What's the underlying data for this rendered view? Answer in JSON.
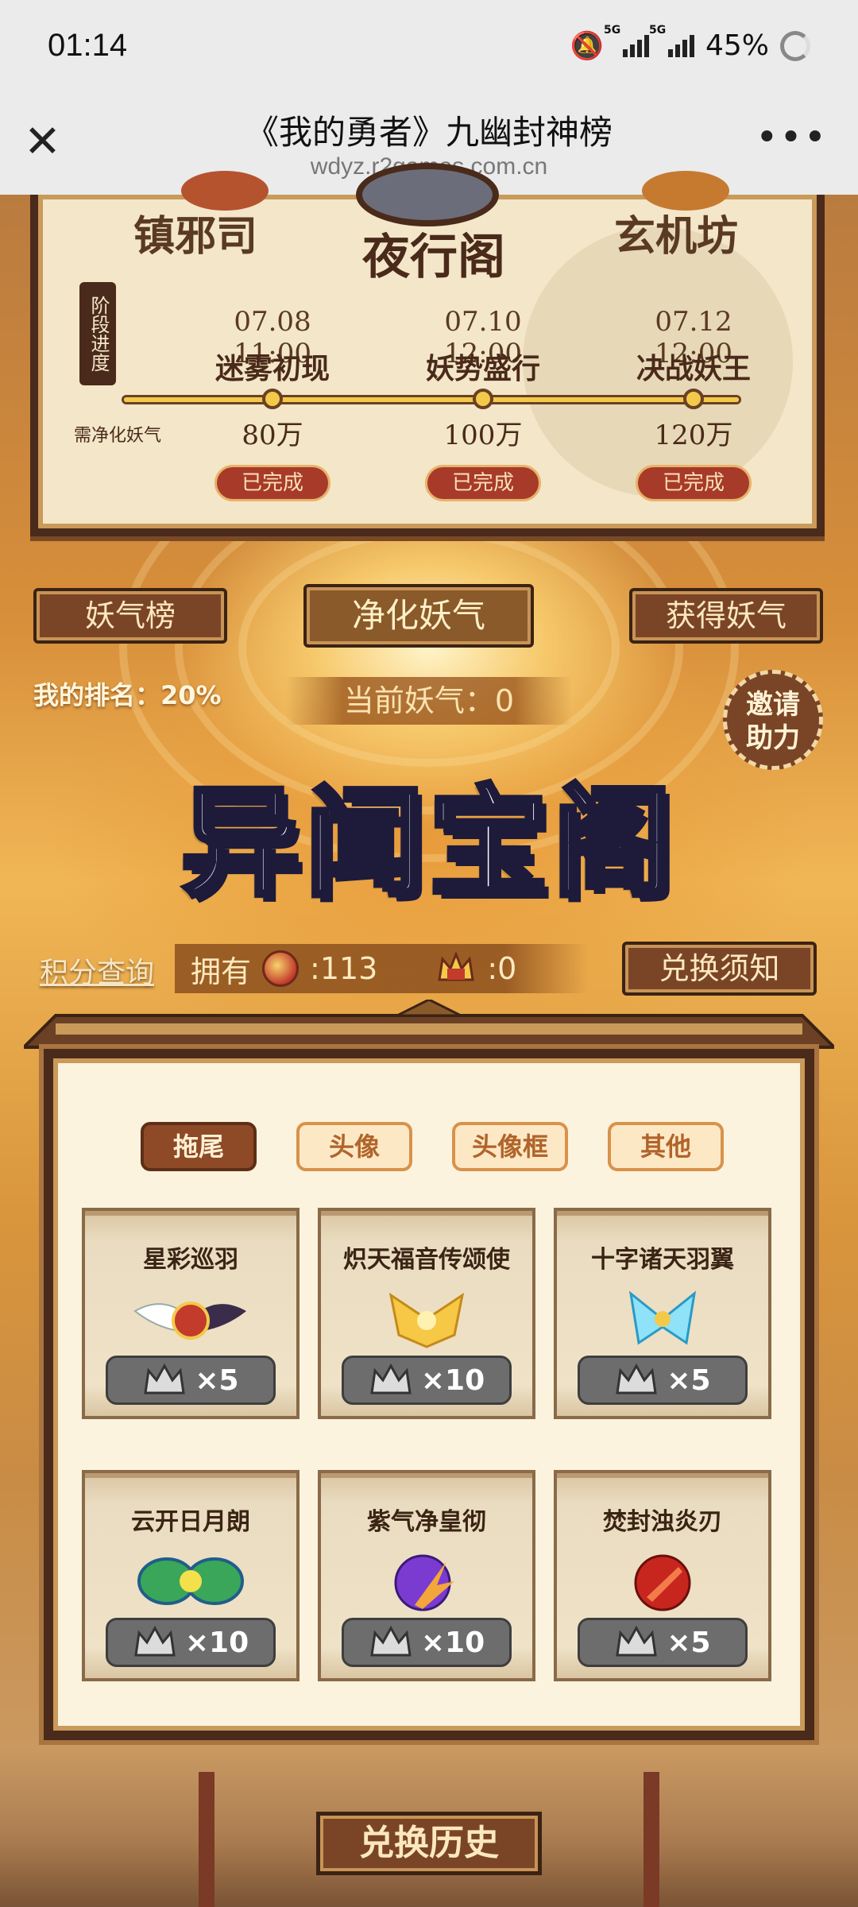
{
  "status_bar": {
    "time": "01:14",
    "network1": "5G",
    "network2": "5G",
    "battery": "45%"
  },
  "browser": {
    "title": "《我的勇者》九幽封神榜",
    "url": "wdyz.r2games.com.cn",
    "close_label": "✕",
    "more_label": "•••"
  },
  "progress": {
    "regions": [
      "镇邪司",
      "夜行阁",
      "玄机坊"
    ],
    "stage_label": "阶段进度",
    "need_label": "需净化妖气",
    "stages": [
      {
        "date": "07.08 11:00",
        "name": "迷雾初现",
        "amount": "80万",
        "status": "已完成"
      },
      {
        "date": "07.10 12:00",
        "name": "妖势盛行",
        "amount": "100万",
        "status": "已完成"
      },
      {
        "date": "07.12 12:00",
        "name": "决战妖王",
        "amount": "120万",
        "status": "已完成"
      }
    ],
    "progress_fraction": 1.0
  },
  "actions": {
    "left_button": "妖气榜",
    "center_button": "净化妖气",
    "right_button": "获得妖气",
    "my_rank": "我的排名：20%",
    "current_qi": "当前妖气：0",
    "invite_line1": "邀请",
    "invite_line2": "助力"
  },
  "shop": {
    "title": "异闻宝阁",
    "points_link": "积分查询",
    "own_label": "拥有",
    "coin_count": ":113",
    "crown_count": ":0",
    "notice_button": "兑换须知",
    "tabs": [
      {
        "label": "拖尾",
        "active": true
      },
      {
        "label": "头像",
        "active": false
      },
      {
        "label": "头像框",
        "active": false
      },
      {
        "label": "其他",
        "active": false
      }
    ],
    "items": [
      {
        "name": "星彩巡羽",
        "price": "×5",
        "icon": "winged-crest-icon"
      },
      {
        "name": "炽天福音传颂使",
        "price": "×10",
        "icon": "golden-wing-icon"
      },
      {
        "name": "十字诸天羽翼",
        "price": "×5",
        "icon": "ice-wing-icon"
      },
      {
        "name": "云开日月朗",
        "price": "×10",
        "icon": "twin-dragon-icon"
      },
      {
        "name": "紫气净皇彻",
        "price": "×10",
        "icon": "purple-flame-icon"
      },
      {
        "name": "焚封浊炎刃",
        "price": "×5",
        "icon": "red-blade-icon"
      }
    ],
    "history_button": "兑换历史"
  },
  "colors": {
    "panel_bg": "#f3e6c9",
    "frame": "#4a2a1a",
    "button_brown": "#7a4526",
    "price_gray": "#6d6d6d",
    "status_red": "#a83a2a"
  }
}
